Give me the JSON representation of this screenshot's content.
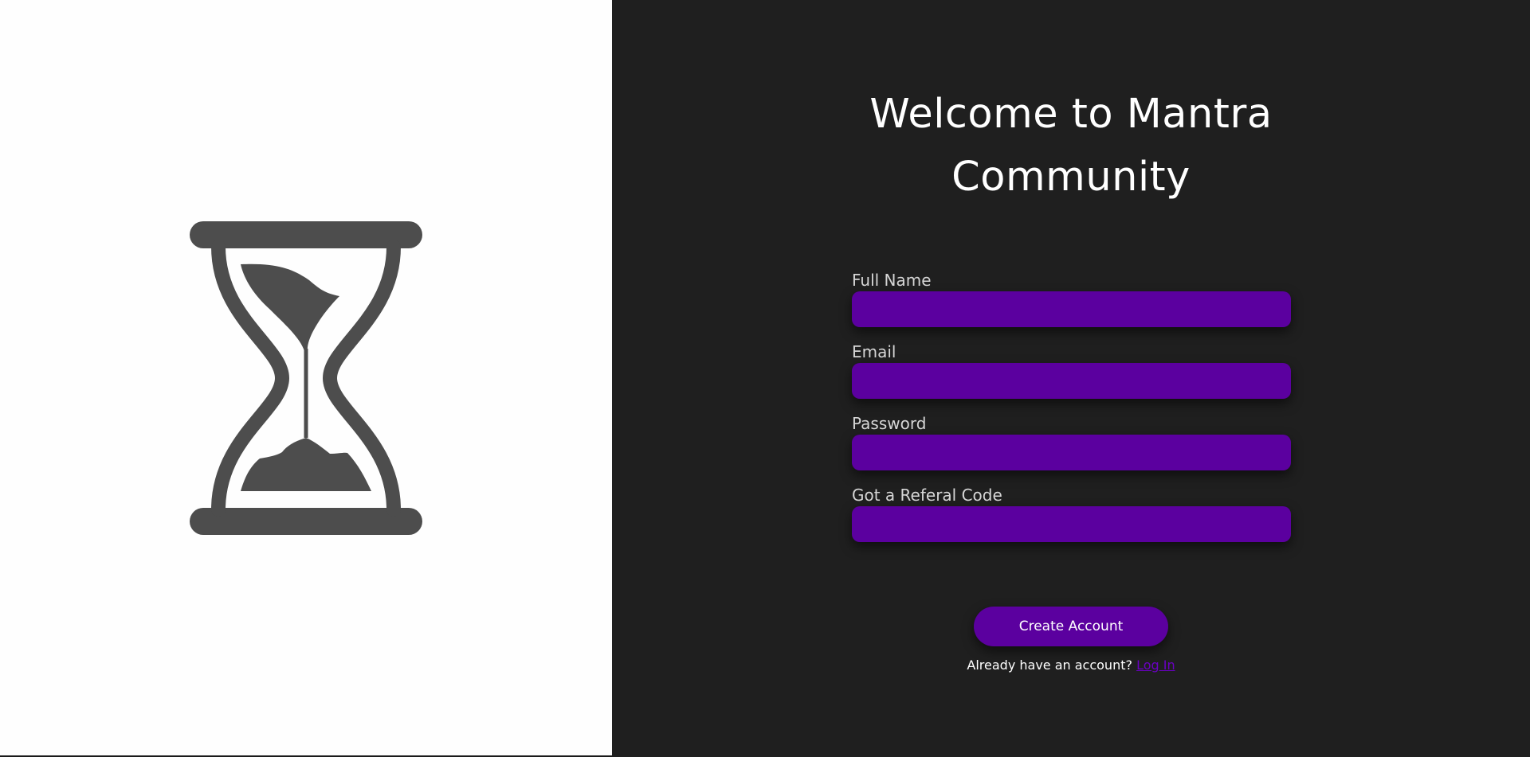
{
  "branding": {
    "logo_icon": "hourglass-icon",
    "colors": {
      "left_background": "#fefefe",
      "right_background": "#1f1f1f",
      "accent": "#5b009f",
      "icon": "#4d4d4d"
    }
  },
  "signup": {
    "title_line1": "Welcome to Mantra",
    "title_line2": "Community",
    "fields": [
      {
        "label": "Full Name",
        "value": ""
      },
      {
        "label": "Email",
        "value": ""
      },
      {
        "label": "Password",
        "value": ""
      },
      {
        "label": "Got a Referal Code",
        "value": ""
      }
    ],
    "submit_label": "Create Account",
    "login_prompt": "Already have an account?",
    "login_link": "Log In"
  }
}
